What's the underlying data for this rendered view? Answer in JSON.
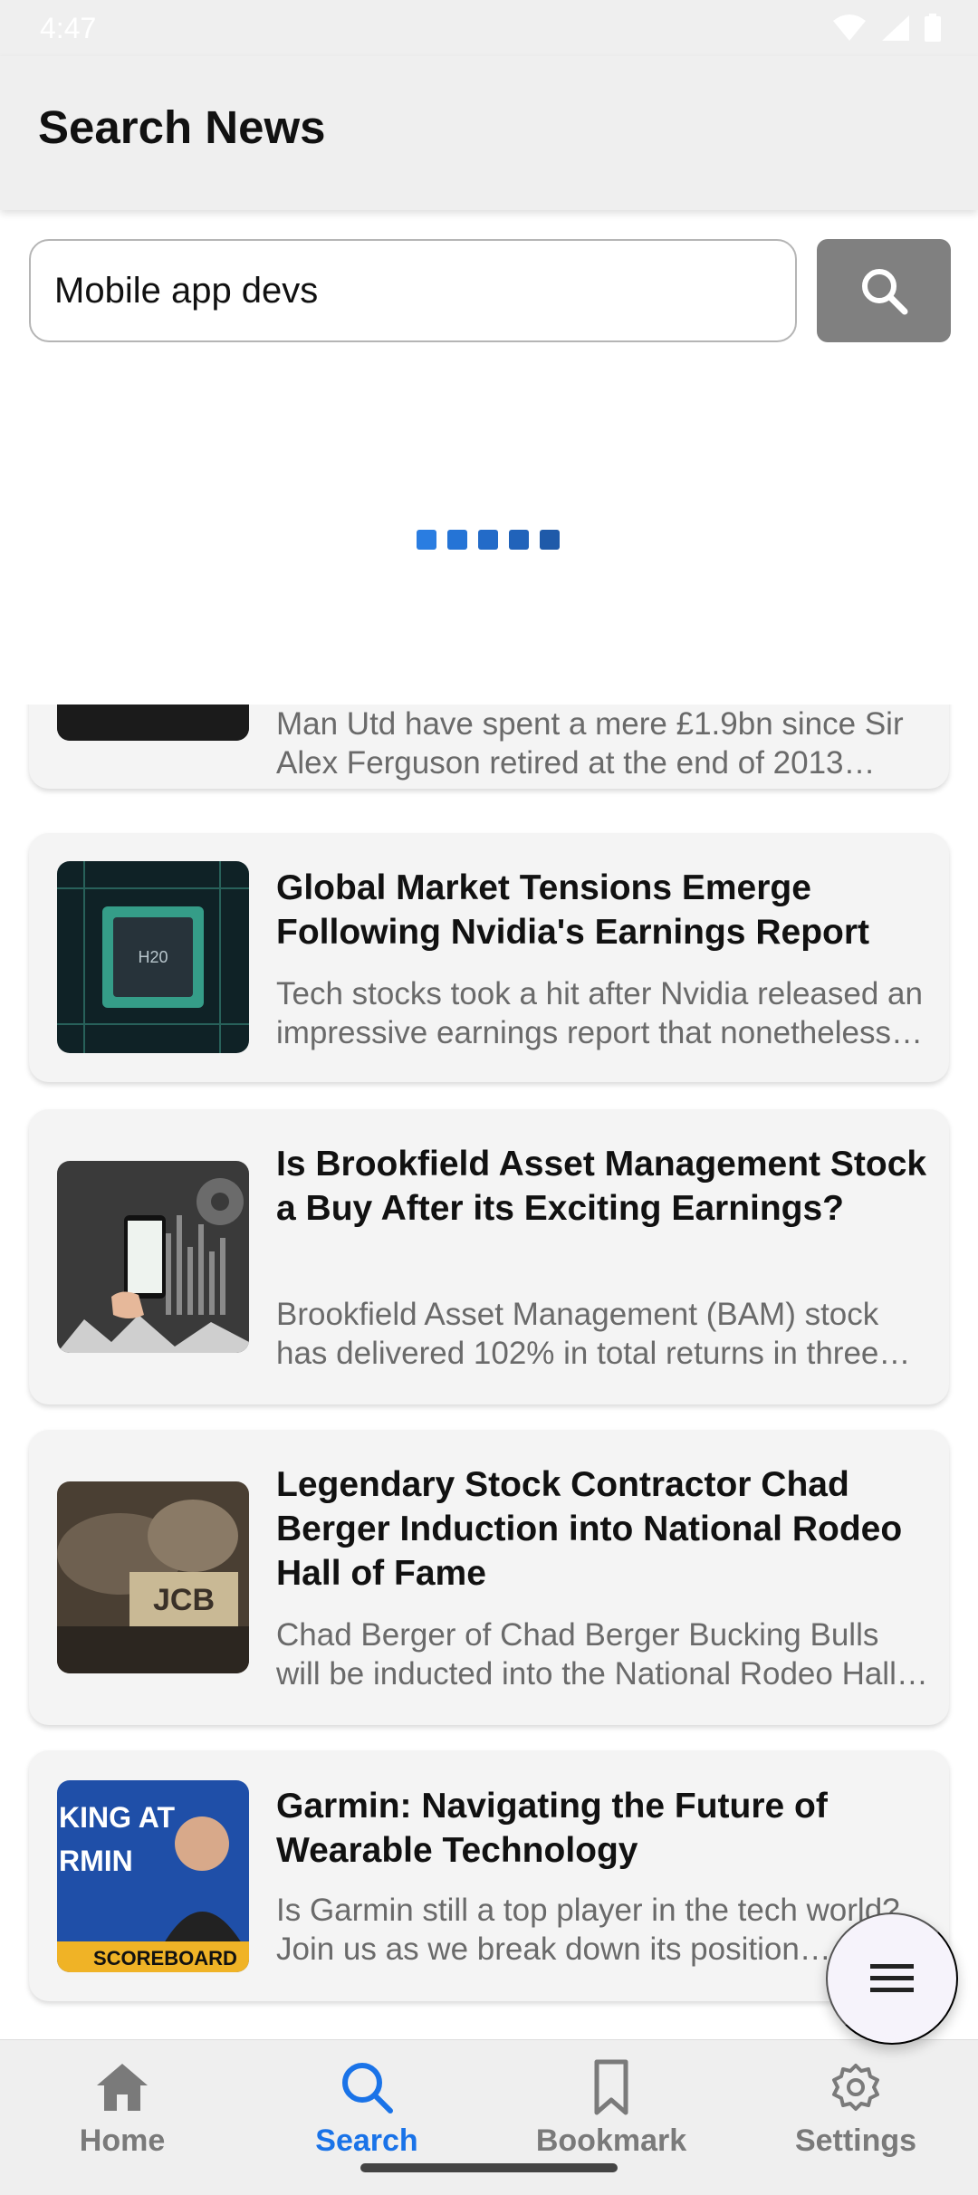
{
  "status_bar": {
    "time": "4:47"
  },
  "app_bar": {
    "title": "Search News"
  },
  "search": {
    "value": "Mobile app devs"
  },
  "loader": {
    "dot_colors": [
      "#2a7de1",
      "#2574d6",
      "#236bc8",
      "#2163ba",
      "#1f5aa9"
    ]
  },
  "articles": [
    {
      "title": "",
      "description": "Man Utd have spent a mere £1.9bn since Sir Alex Ferguson retired at the end of 2013…",
      "thumb": "football-photo"
    },
    {
      "title": "Global Market Tensions Emerge Following Nvidia's Earnings Report",
      "description": "Tech stocks took a hit after Nvidia released an impressive earnings report that nonetheless…",
      "thumb": "chip-photo",
      "thumb_text": "H20"
    },
    {
      "title": "Is Brookfield Asset Management Stock a Buy After its Exciting Earnings?",
      "description": "Brookfield Asset Management (BAM) stock has delivered 102% in total returns in three…",
      "thumb": "phone-chart-photo"
    },
    {
      "title": "Legendary Stock Contractor Chad Berger Induction into National Rodeo Hall of Fame",
      "description": "Chad Berger of Chad Berger Bucking Bulls will be inducted into the National Rodeo Hall…",
      "thumb": "rodeo-photo",
      "thumb_text": "JCB"
    },
    {
      "title": "Garmin: Navigating the Future of Wearable Technology",
      "description": "Is Garmin still a top player in the tech world? Join us as we break down its position…",
      "thumb": "scoreboard-thumbnail",
      "thumb_text_1": "KING AT",
      "thumb_text_2": "RMIN",
      "thumb_text_3": "SCOREBOARD"
    }
  ],
  "fab": {
    "icon": "menu-icon"
  },
  "bottom_nav": {
    "items": [
      {
        "label": "Home",
        "icon": "home-icon"
      },
      {
        "label": "Search",
        "icon": "search-icon"
      },
      {
        "label": "Bookmark",
        "icon": "bookmark-icon"
      },
      {
        "label": "Settings",
        "icon": "settings-icon"
      }
    ],
    "active": "Search"
  },
  "colors": {
    "accent": "#1a73e8",
    "inactive": "#7a7a7a",
    "bar": "#efefef"
  }
}
